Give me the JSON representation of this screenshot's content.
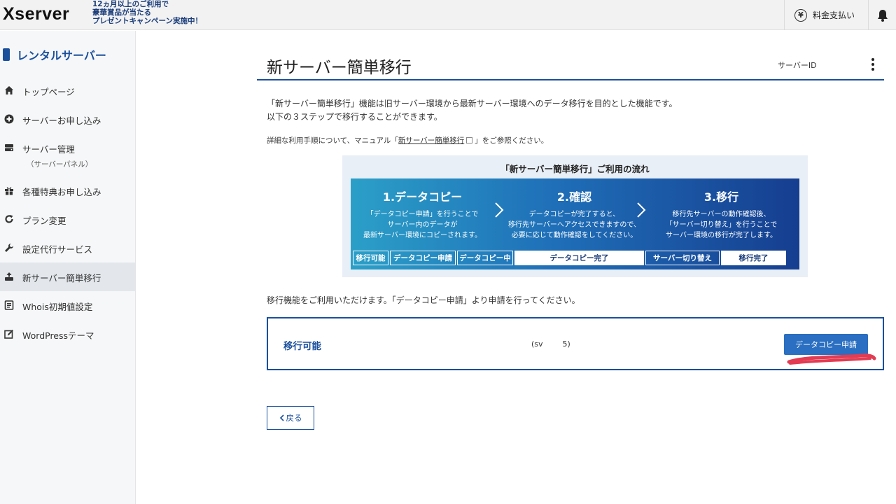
{
  "header": {
    "logo": "Xserver",
    "promo_lines": [
      "12ヵ月以上のご利用で",
      "豪華賞品が当たる",
      "プレゼントキャンペーン実施中！"
    ],
    "pay_label": "料金支払い",
    "yen_symbol": "¥"
  },
  "sidebar": {
    "title": "レンタルサーバー",
    "items": [
      {
        "label": "トップページ",
        "icon": "home-icon"
      },
      {
        "label": "サーバーお申し込み",
        "icon": "plus-circle-icon"
      },
      {
        "label": "サーバー管理",
        "sub": "（サーバーパネル）",
        "icon": "server-icon"
      },
      {
        "label": "各種特典お申し込み",
        "icon": "gift-icon"
      },
      {
        "label": "プラン変更",
        "icon": "refresh-icon"
      },
      {
        "label": "設定代行サービス",
        "icon": "wrench-icon"
      },
      {
        "label": "新サーバー簡単移行",
        "icon": "migrate-icon",
        "active": true
      },
      {
        "label": "Whois初期値設定",
        "icon": "document-icon"
      },
      {
        "label": "WordPressテーマ",
        "icon": "edit-icon"
      }
    ]
  },
  "main": {
    "title": "新サーバー簡単移行",
    "server_id_label": "サーバーID",
    "desc_line1": "「新サーバー簡単移行」機能は旧サーバー環境から最新サーバー環境へのデータ移行を目的とした機能です。",
    "desc_line2": "以下の３ステップで移行することができます。",
    "manual_prefix": "詳細な利用手順について、マニュアル「",
    "manual_link": "新サーバー簡単移行",
    "manual_suffix": "」をご参照ください。",
    "flow": {
      "title": "「新サーバー簡単移行」ご利用の流れ",
      "steps": [
        {
          "heading": "1.データコピー",
          "lines": [
            "「データコピー申請」を行うことで",
            "サーバー内のデータが",
            "最新サーバー環境にコピーされます。"
          ]
        },
        {
          "heading": "2.確認",
          "lines": [
            "データコピーが完了すると、",
            "移行先サーバーへアクセスできますので、",
            "必要に応じて動作確認をしてください。"
          ]
        },
        {
          "heading": "3.移行",
          "lines": [
            "移行先サーバーの動作確認後、",
            "「サーバー切り替え」を行うことで",
            "サーバー環境の移行が完了します。"
          ]
        }
      ],
      "statuses": [
        "移行可能",
        "データコピー申請",
        "データコピー中",
        "データコピー完了",
        "サーバー切り替え",
        "移行完了"
      ]
    },
    "available_text": "移行機能をご利用いただけます。「データコピー申請」より申請を行ってください。",
    "panel": {
      "status": "移行可能",
      "server": "(sv        5)",
      "button": "データコピー申請"
    },
    "back_label": "戻る"
  }
}
